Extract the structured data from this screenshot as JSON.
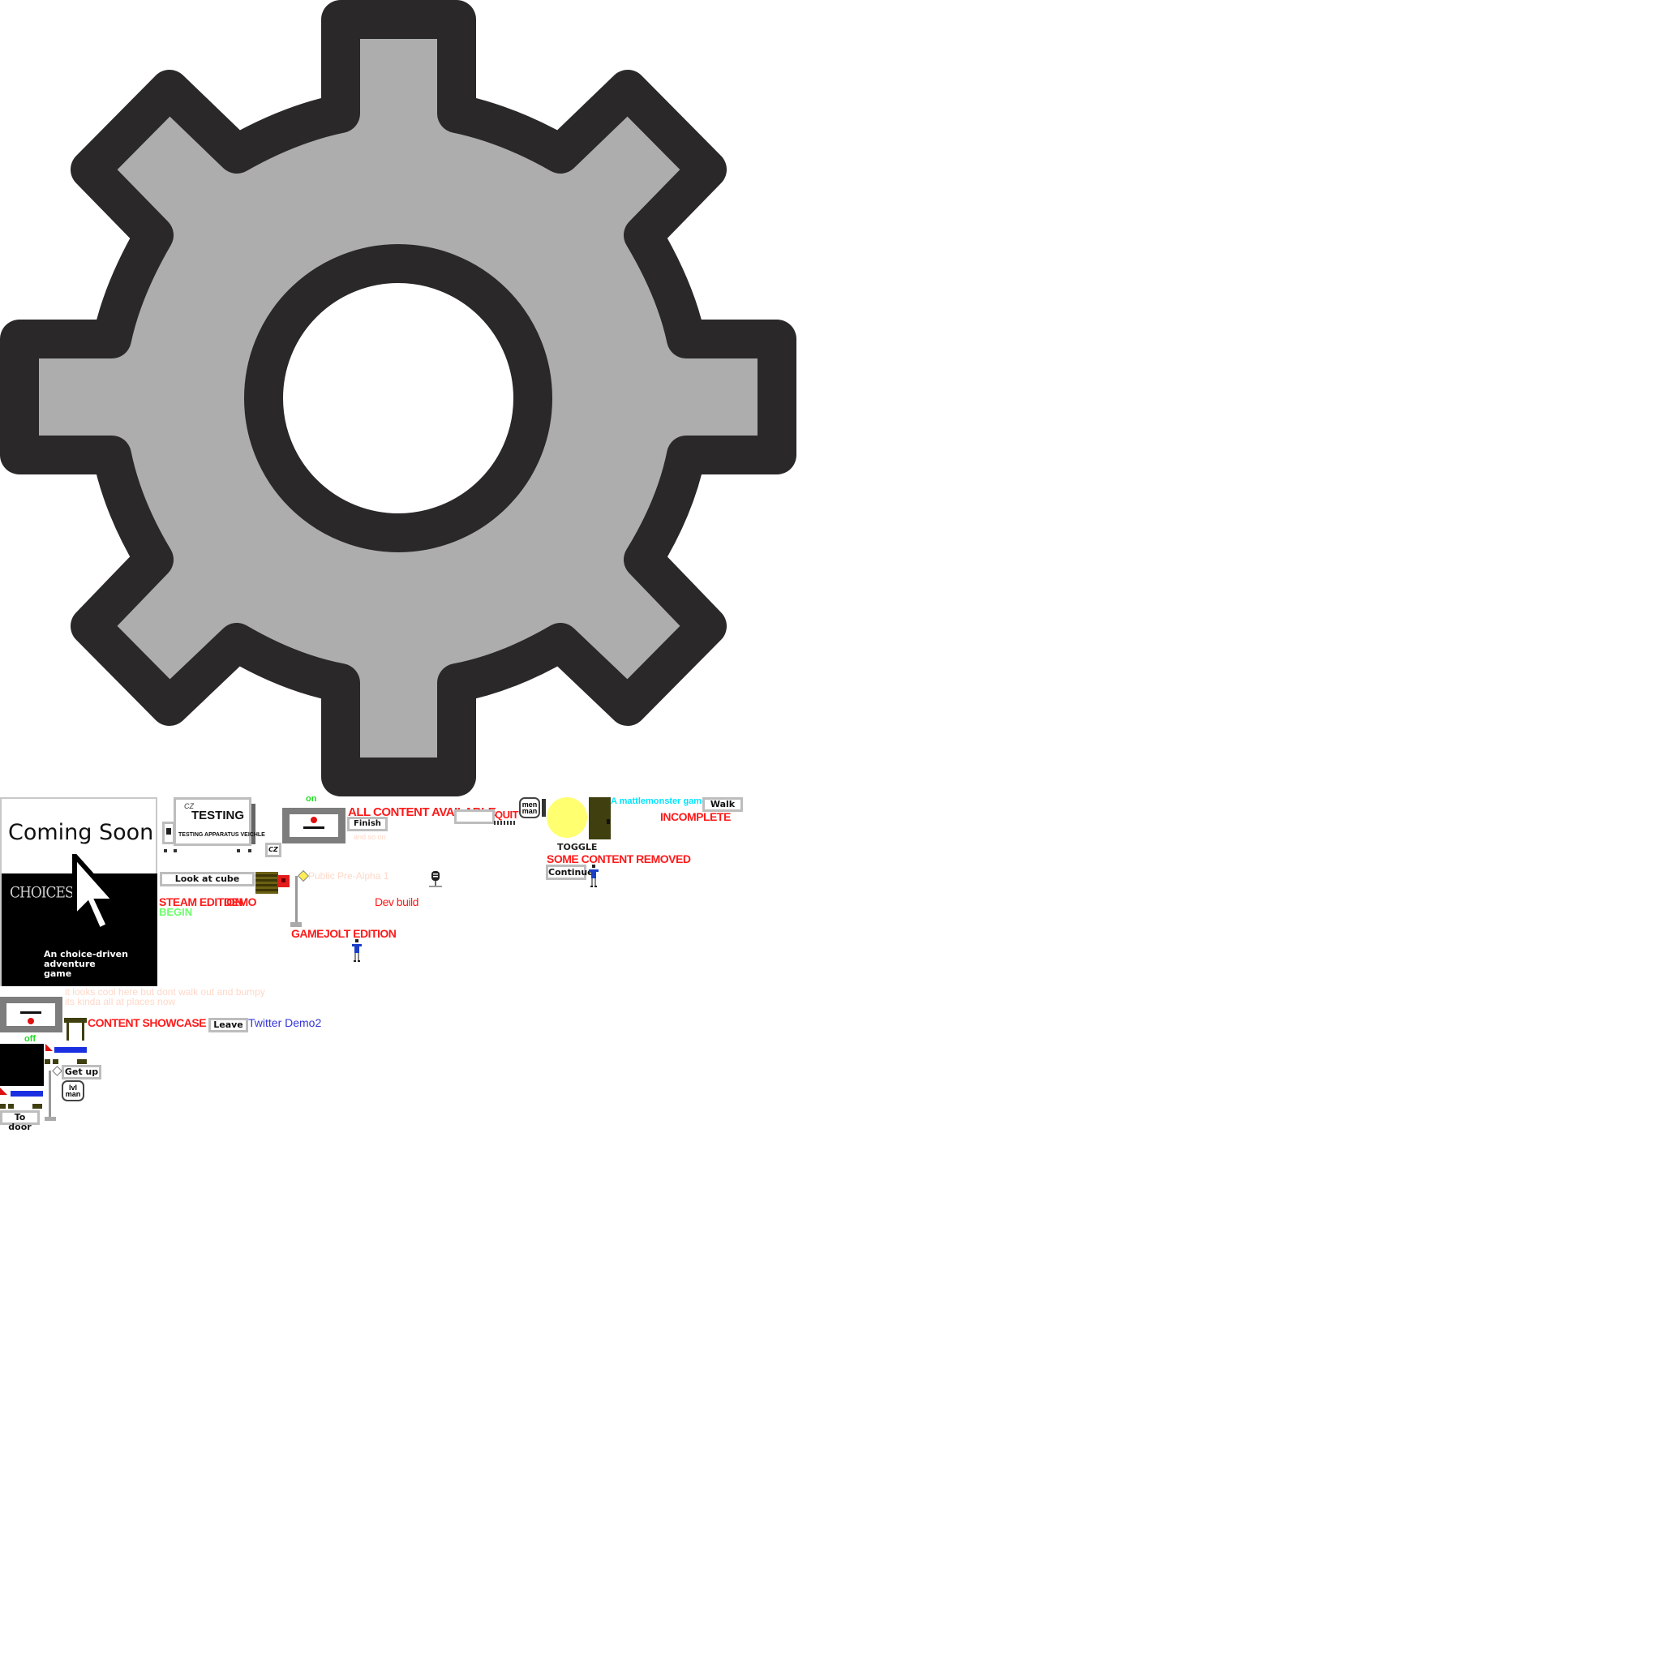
{
  "gear": {
    "icon": "gear-icon",
    "fill": "#adadad",
    "stroke": "#2a2829"
  },
  "poster": {
    "coming_soon": "Coming Soon",
    "logo": "CHOICES",
    "tagline_1": "An choice-driven",
    "tagline_2": "adventure",
    "tagline_3": "game"
  },
  "testing_box": {
    "badge": "CZ",
    "title": "TESTING",
    "subtitle": "TESTING APPARATUS VEICHLE",
    "side_label": "CZ"
  },
  "labels": {
    "on": "on",
    "off": "off",
    "all_content": "ALL CONTENT AVAILABLE",
    "quit": "QUIT",
    "mattlemonster": "A mattlemonster game",
    "incomplete": "INCOMPLETE",
    "toggle": "TOGGLE",
    "some_removed": "SOME CONTENT REMOVED",
    "steam_edition": "STEAM EDITION",
    "demo": "DEMO",
    "begin": "BEGIN",
    "dev_build": "Dev build",
    "public_pre_alpha": "Public Pre-Alpha 1",
    "gamejolt": "GAMEJOLT EDITION",
    "content_showcase": "CONTENT SHOWCASE DEMO",
    "twitter_demo": "Twitter Demo2",
    "faint_line_1": "it looks cool here but dont walk out and bumpy",
    "faint_line_2": "its kinda all at places now",
    "faint_finish": "and so on"
  },
  "buttons": {
    "finish": "Finish",
    "walk": "Walk",
    "continue": "Continue",
    "look_at_cube": "Look at cube",
    "leave": "Leave",
    "get_up": "Get up",
    "to_door": "To door"
  },
  "badges": {
    "menu_man_1": "men",
    "menu_man_2": "man",
    "lvl_man_1": "lvl",
    "lvl_man_2": "man"
  }
}
